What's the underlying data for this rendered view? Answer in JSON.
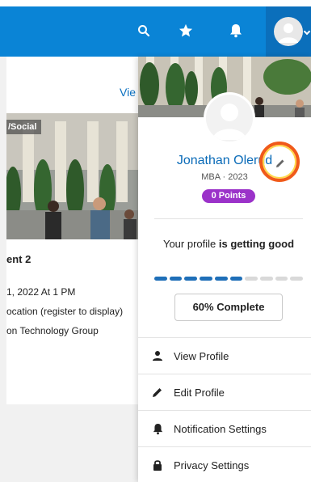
{
  "topbar": {
    "icons": [
      "search-icon",
      "star-icon",
      "bell-icon"
    ],
    "accent": "#0a84d6",
    "avatar_bg": "#0b6fbb"
  },
  "background_page": {
    "view_link": "Vie",
    "event_tag": "/Social",
    "event_title": "ent 2",
    "event_lines": [
      "1, 2022 At 1 PM",
      "ocation (register to display)",
      "on Technology Group"
    ]
  },
  "profile": {
    "name": "Jonathan Olerud",
    "subtitle": "MBA · 2023",
    "points": "0 Points",
    "points_color": "#9b32c9",
    "progress_text_lead": "Your profile ",
    "progress_text_bold": "is getting good",
    "progress_segments_total": 10,
    "progress_segments_filled": 6,
    "progress_filled_color": "#1f6fb8",
    "progress_empty_color": "#d9d9d9",
    "complete_label": "60% Complete"
  },
  "menu": [
    {
      "label": "View Profile",
      "icon": "person-icon"
    },
    {
      "label": "Edit Profile",
      "icon": "pencil-icon"
    },
    {
      "label": "Notification Settings",
      "icon": "bell-icon"
    },
    {
      "label": "Privacy Settings",
      "icon": "lock-icon"
    }
  ]
}
